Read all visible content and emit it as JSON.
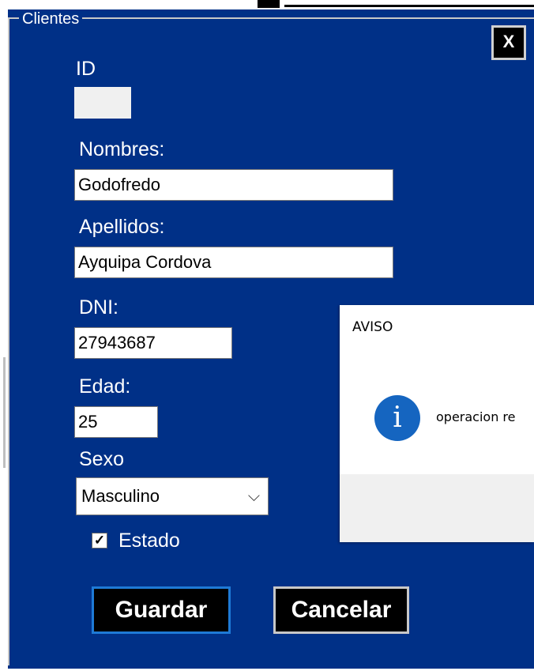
{
  "form": {
    "group_title": "Clientes",
    "close_label": "X",
    "labels": {
      "id": "ID",
      "nombres": "Nombres:",
      "apellidos": "Apellidos:",
      "dni": "DNI:",
      "edad": "Edad:",
      "sexo": "Sexo"
    },
    "values": {
      "id": "",
      "nombres": "Godofredo",
      "apellidos": "Ayquipa Cordova",
      "dni": "27943687",
      "edad": "25"
    },
    "sexo": {
      "selected": "Masculino",
      "chevron": "⌵"
    },
    "estado": {
      "label": "Estado",
      "checked": true,
      "mark": "✓"
    },
    "buttons": {
      "guardar": "Guardar",
      "cancelar": "Cancelar"
    },
    "colors": {
      "background": "#003087",
      "accent_border": "#1e7ad6"
    }
  },
  "dialog": {
    "title": "AVISO",
    "icon": "information-icon",
    "icon_glyph": "i",
    "message": "operacion re"
  }
}
